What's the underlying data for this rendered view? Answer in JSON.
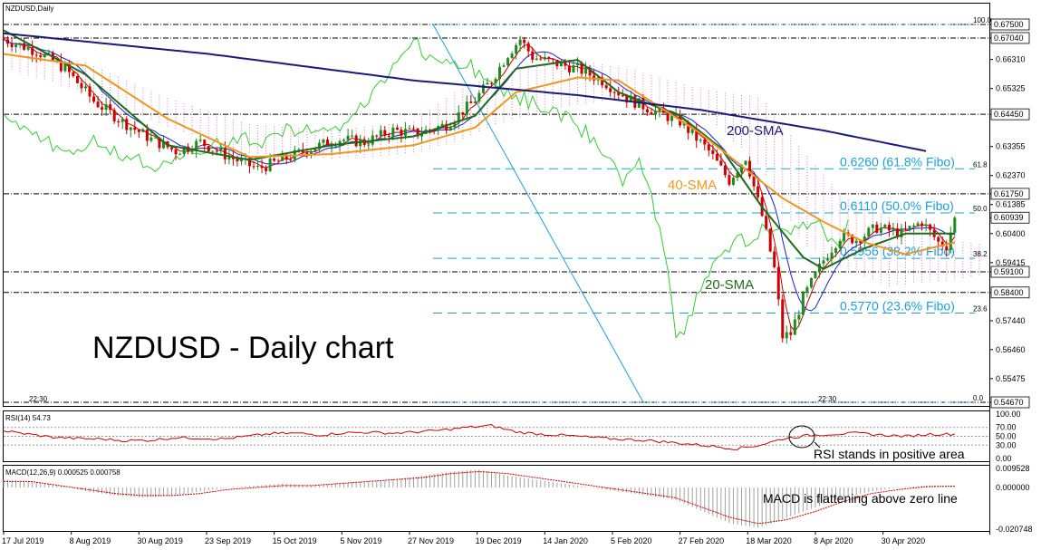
{
  "chart_data": [
    {
      "type": "candlestick",
      "symbol_label": "NZDUSD,Daily",
      "title": "NZDUSD - Daily chart",
      "ylim": [
        0.5467,
        0.675
      ],
      "y_ticks": [
        "0.67500",
        "0.67040",
        "0.66310",
        "0.65325",
        "0.64450",
        "0.63355",
        "0.62370",
        "0.61750",
        "0.61385",
        "0.60939",
        "0.60400",
        "0.59415",
        "0.59100",
        "0.58400",
        "0.57440",
        "0.56460",
        "0.55475",
        "0.54670"
      ],
      "highlighted_levels": [
        {
          "label": "0.67500",
          "price": 0.675,
          "style": "dash-dot"
        },
        {
          "label": "0.67040",
          "price": 0.6704,
          "style": "dash-dot"
        },
        {
          "label": "0.64450",
          "price": 0.6445,
          "style": "dash-dot"
        },
        {
          "label": "0.61750",
          "price": 0.6175,
          "style": "dash-dot"
        },
        {
          "label": "0.60939",
          "price": 0.60939,
          "style": "current"
        },
        {
          "label": "0.59100",
          "price": 0.591,
          "style": "dash-dot"
        },
        {
          "label": "0.58400",
          "price": 0.584,
          "style": "dash-dot"
        },
        {
          "label": "0.54670",
          "price": 0.5467,
          "style": "dash-dot"
        }
      ],
      "fibonacci": [
        {
          "level_tag": "100.0",
          "price": 0.675,
          "label": ""
        },
        {
          "level_tag": "61.8",
          "price": 0.626,
          "label": "0.6260 (61.8% Fibo)"
        },
        {
          "level_tag": "50.0",
          "price": 0.611,
          "label": "0.6110 (50.0% Fibo)"
        },
        {
          "level_tag": "38.2",
          "price": 0.5956,
          "label": "0.5956 (38.2% Fibo)"
        },
        {
          "level_tag": "23.6",
          "price": 0.577,
          "label": "0.5770 (23.6% Fibo)"
        },
        {
          "level_tag": "0.0",
          "price": 0.5467,
          "label": ""
        }
      ],
      "x_labels": [
        "17 Jul 2019",
        "8 Aug 2019",
        "30 Aug 2019",
        "23 Sep 2019",
        "15 Oct 2019",
        "5 Nov 2019",
        "27 Nov 2019",
        "19 Dec 2019",
        "14 Jan 2020",
        "5 Feb 2020",
        "27 Feb 2020",
        "18 Mar 2020",
        "8 Apr 2020",
        "30 Apr 2020"
      ],
      "close_path": [
        [
          0,
          0.67
        ],
        [
          8,
          0.666
        ],
        [
          15,
          0.66
        ],
        [
          22,
          0.649
        ],
        [
          29,
          0.642
        ],
        [
          36,
          0.636
        ],
        [
          42,
          0.632
        ],
        [
          48,
          0.635
        ],
        [
          55,
          0.63
        ],
        [
          62,
          0.626
        ],
        [
          68,
          0.629
        ],
        [
          75,
          0.633
        ],
        [
          82,
          0.636
        ],
        [
          88,
          0.635
        ],
        [
          95,
          0.639
        ],
        [
          101,
          0.638
        ],
        [
          108,
          0.641
        ],
        [
          114,
          0.648
        ],
        [
          119,
          0.656
        ],
        [
          123,
          0.665
        ],
        [
          126,
          0.67
        ],
        [
          129,
          0.664
        ],
        [
          134,
          0.662
        ],
        [
          140,
          0.66
        ],
        [
          146,
          0.656
        ],
        [
          152,
          0.65
        ],
        [
          158,
          0.646
        ],
        [
          165,
          0.642
        ],
        [
          172,
          0.632
        ],
        [
          177,
          0.622
        ],
        [
          181,
          0.63
        ],
        [
          185,
          0.61
        ],
        [
          188,
          0.592
        ],
        [
          190,
          0.569
        ],
        [
          192,
          0.57
        ],
        [
          195,
          0.582
        ],
        [
          200,
          0.595
        ],
        [
          204,
          0.603
        ],
        [
          208,
          0.602
        ],
        [
          213,
          0.606
        ],
        [
          219,
          0.604
        ],
        [
          224,
          0.608
        ],
        [
          228,
          0.601
        ],
        [
          230,
          0.6
        ],
        [
          232,
          0.6094
        ]
      ],
      "series": [
        {
          "name": "20-SMA",
          "color": "#1f6b1f",
          "path": [
            [
              0,
              0.673
            ],
            [
              20,
              0.658
            ],
            [
              40,
              0.634
            ],
            [
              60,
              0.629
            ],
            [
              80,
              0.634
            ],
            [
              100,
              0.637
            ],
            [
              115,
              0.644
            ],
            [
              125,
              0.66
            ],
            [
              140,
              0.663
            ],
            [
              150,
              0.652
            ],
            [
              165,
              0.644
            ],
            [
              175,
              0.633
            ],
            [
              185,
              0.613
            ],
            [
              195,
              0.596
            ],
            [
              200,
              0.592
            ],
            [
              210,
              0.599
            ],
            [
              220,
              0.604
            ],
            [
              232,
              0.604
            ]
          ]
        },
        {
          "name": "40-SMA",
          "color": "#f0961e",
          "path": [
            [
              0,
              0.665
            ],
            [
              20,
              0.661
            ],
            [
              40,
              0.643
            ],
            [
              60,
              0.63
            ],
            [
              80,
              0.631
            ],
            [
              100,
              0.634
            ],
            [
              115,
              0.64
            ],
            [
              125,
              0.652
            ],
            [
              140,
              0.657
            ],
            [
              150,
              0.656
            ],
            [
              160,
              0.647
            ],
            [
              170,
              0.638
            ],
            [
              180,
              0.627
            ],
            [
              190,
              0.616
            ],
            [
              200,
              0.608
            ],
            [
              210,
              0.601
            ],
            [
              220,
              0.597
            ],
            [
              232,
              0.601
            ]
          ]
        },
        {
          "name": "200-SMA",
          "color": "#1a1a7a",
          "path": [
            [
              0,
              0.672
            ],
            [
              50,
              0.665
            ],
            [
              100,
              0.656
            ],
            [
              140,
              0.651
            ],
            [
              170,
              0.646
            ],
            [
              200,
              0.639
            ],
            [
              225,
              0.632
            ]
          ]
        }
      ],
      "annotations": [
        "200-SMA",
        "40-SMA",
        "20-SMA"
      ],
      "time_label": "22:30"
    },
    {
      "type": "line",
      "title": "RSI(14) 54.73",
      "ylim": [
        0,
        100
      ],
      "y_ticks": [
        "100.00",
        "70.00",
        "50.00",
        "30.00",
        "0.00"
      ],
      "series": [
        {
          "name": "RSI(14)",
          "color": "#cc0000",
          "values": [
            62,
            55,
            48,
            45,
            44,
            40,
            41,
            47,
            46,
            44,
            50,
            56,
            57,
            53,
            58,
            59,
            57,
            60,
            64,
            70,
            74,
            60,
            55,
            52,
            48,
            44,
            42,
            38,
            33,
            28,
            22,
            30,
            45,
            52,
            55,
            57,
            53,
            50,
            55,
            54.73
          ]
        }
      ],
      "annotation": "RSI stands in positive area"
    },
    {
      "type": "histogram",
      "title": "MACD(12,26,9) 0.000525 0.000758",
      "ylim": [
        -0.020748,
        0.009528
      ],
      "y_ticks": [
        "0.009528",
        "0.000000",
        "-0.020748"
      ],
      "histogram": [
        0.004,
        0.003,
        0.001,
        -0.002,
        -0.004,
        -0.005,
        -0.004,
        -0.002,
        0.0,
        0.001,
        0.002,
        0.001,
        0.002,
        0.003,
        0.004,
        0.006,
        0.008,
        0.009,
        0.006,
        0.004,
        0.002,
        0.0,
        -0.002,
        -0.004,
        -0.006,
        -0.012,
        -0.018,
        -0.02,
        -0.015,
        -0.01,
        -0.005,
        -0.002,
        0.0,
        0.001,
        0.0005
      ],
      "signal": [
        0.003,
        0.003,
        0.001,
        -0.001,
        -0.003,
        -0.004,
        -0.004,
        -0.003,
        -0.001,
        0.0,
        0.001,
        0.001,
        0.002,
        0.003,
        0.004,
        0.005,
        0.007,
        0.008,
        0.007,
        0.005,
        0.003,
        0.001,
        -0.001,
        -0.003,
        -0.005,
        -0.01,
        -0.015,
        -0.018,
        -0.016,
        -0.012,
        -0.007,
        -0.003,
        -0.001,
        0.0005,
        0.00076
      ],
      "annotation": "MACD is flattening above zero line"
    }
  ],
  "colors": {
    "candle_up": "#1f8a1f",
    "candle_down": "#cc0000",
    "tenkan": "#cc0000",
    "kijun": "#1f1fd0",
    "chikou": "#33cc33",
    "cloud": "#e07ab8",
    "fib": "#1aa0d8",
    "trendline": "#1aa0d8",
    "ref_line": "#000000"
  }
}
